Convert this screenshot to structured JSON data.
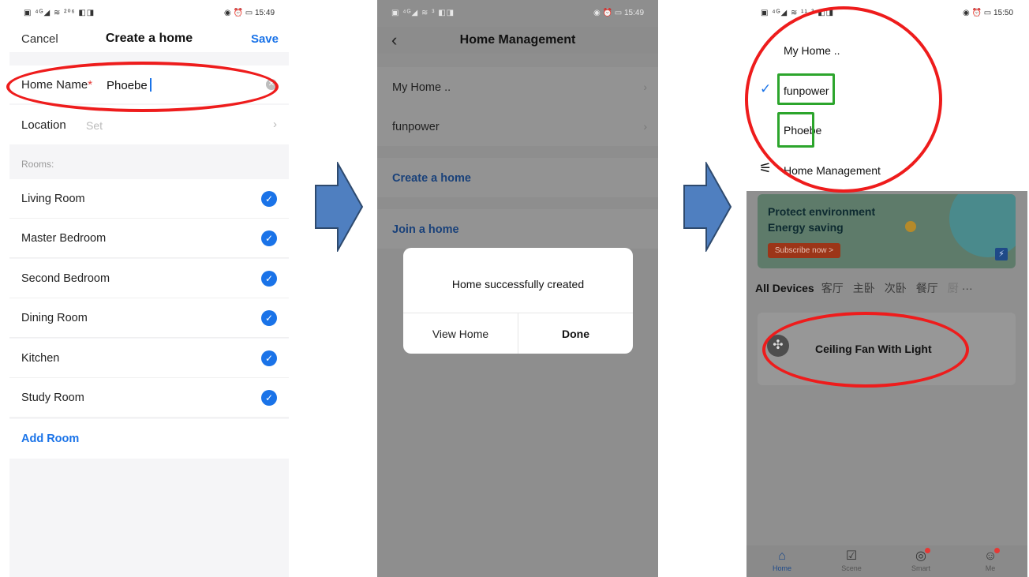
{
  "phone1": {
    "status_left": "▣ ⁴ᴳ◢ ≋ ²⁰⁶ ◧◨",
    "status_right": "◉ ⏰ ▭ 15:49",
    "nav": {
      "cancel": "Cancel",
      "title": "Create a home",
      "save": "Save"
    },
    "home_name": {
      "label": "Home Name",
      "required_mark": "*",
      "value": "Phoebe"
    },
    "location": {
      "label": "Location",
      "value": "Set"
    },
    "rooms_header": "Rooms:",
    "rooms": [
      {
        "name": "Living Room",
        "checked": true
      },
      {
        "name": "Master Bedroom",
        "checked": true
      },
      {
        "name": "Second Bedroom",
        "checked": true
      },
      {
        "name": "Dining Room",
        "checked": true
      },
      {
        "name": "Kitchen",
        "checked": true
      },
      {
        "name": "Study Room",
        "checked": true
      }
    ],
    "add_room": "Add Room"
  },
  "phone2": {
    "status_left": "▣ ⁴ᴳ◢ ≋ ³ ◧◨",
    "status_right": "◉ ⏰ ▭ 15:49",
    "title": "Home Management",
    "homes": [
      "My Home ..",
      "funpower"
    ],
    "create": "Create a home",
    "join": "Join a home",
    "dialog": {
      "message": "Home successfully created",
      "view": "View Home",
      "done": "Done"
    }
  },
  "phone3": {
    "status_left": "▣ ⁴ᴳ◢ ≋ ¹¹·³ ◧◨",
    "status_right": "◉ ⏰ ▭ 15:50",
    "dropdown": {
      "items": [
        "My Home ..",
        "funpower",
        "Phoebe"
      ],
      "selected": "funpower",
      "management": "Home Management"
    },
    "banner": {
      "line1": "Protect environment",
      "line2": "Energy saving",
      "button": "Subscribe now >"
    },
    "tabs": [
      "All Devices",
      "客厅",
      "主卧",
      "次卧",
      "餐厅",
      "厨",
      "···"
    ],
    "device": "Ceiling Fan With Light",
    "bottom_nav": [
      "Home",
      "Scene",
      "Smart",
      "Me"
    ]
  },
  "colors": {
    "accent": "#1a73e8",
    "highlight_red": "#ee1c1c",
    "highlight_green": "#2ca52c",
    "arrow": "#4f7fc0"
  }
}
